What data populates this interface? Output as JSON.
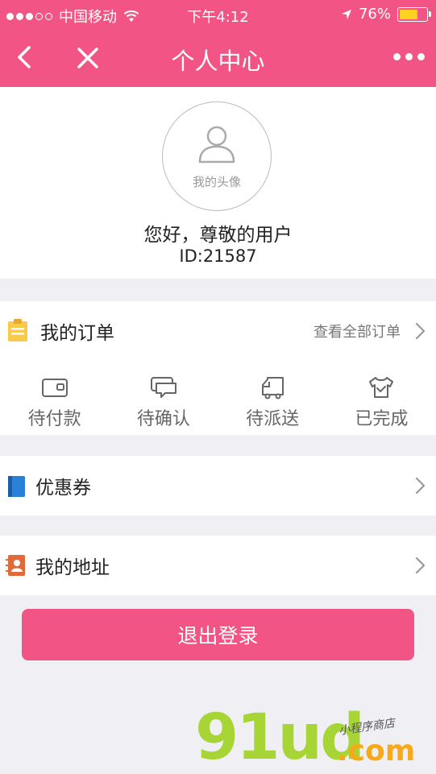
{
  "status_bar": {
    "carrier": "中国移动",
    "time": "下午4:12",
    "battery_percent": "76%",
    "battery_level": 0.76,
    "signal_filled": 3,
    "signal_total": 5
  },
  "nav": {
    "title": "个人中心"
  },
  "profile": {
    "avatar_caption": "我的头像",
    "greeting": "您好，尊敬的用户",
    "user_id": "ID:21587"
  },
  "orders": {
    "title": "我的订单",
    "view_all": "查看全部订单",
    "statuses": [
      "待付款",
      "待确认",
      "待派送",
      "已完成"
    ]
  },
  "menu": {
    "coupons": "优惠券",
    "address": "我的地址"
  },
  "logout_label": "退出登录",
  "watermark": {
    "brand": "91ud",
    "tld": ".com",
    "tagline": "小程序商店"
  },
  "colors": {
    "accent": "#f25585",
    "background": "#efeff4",
    "battery": "#ffd21f"
  }
}
